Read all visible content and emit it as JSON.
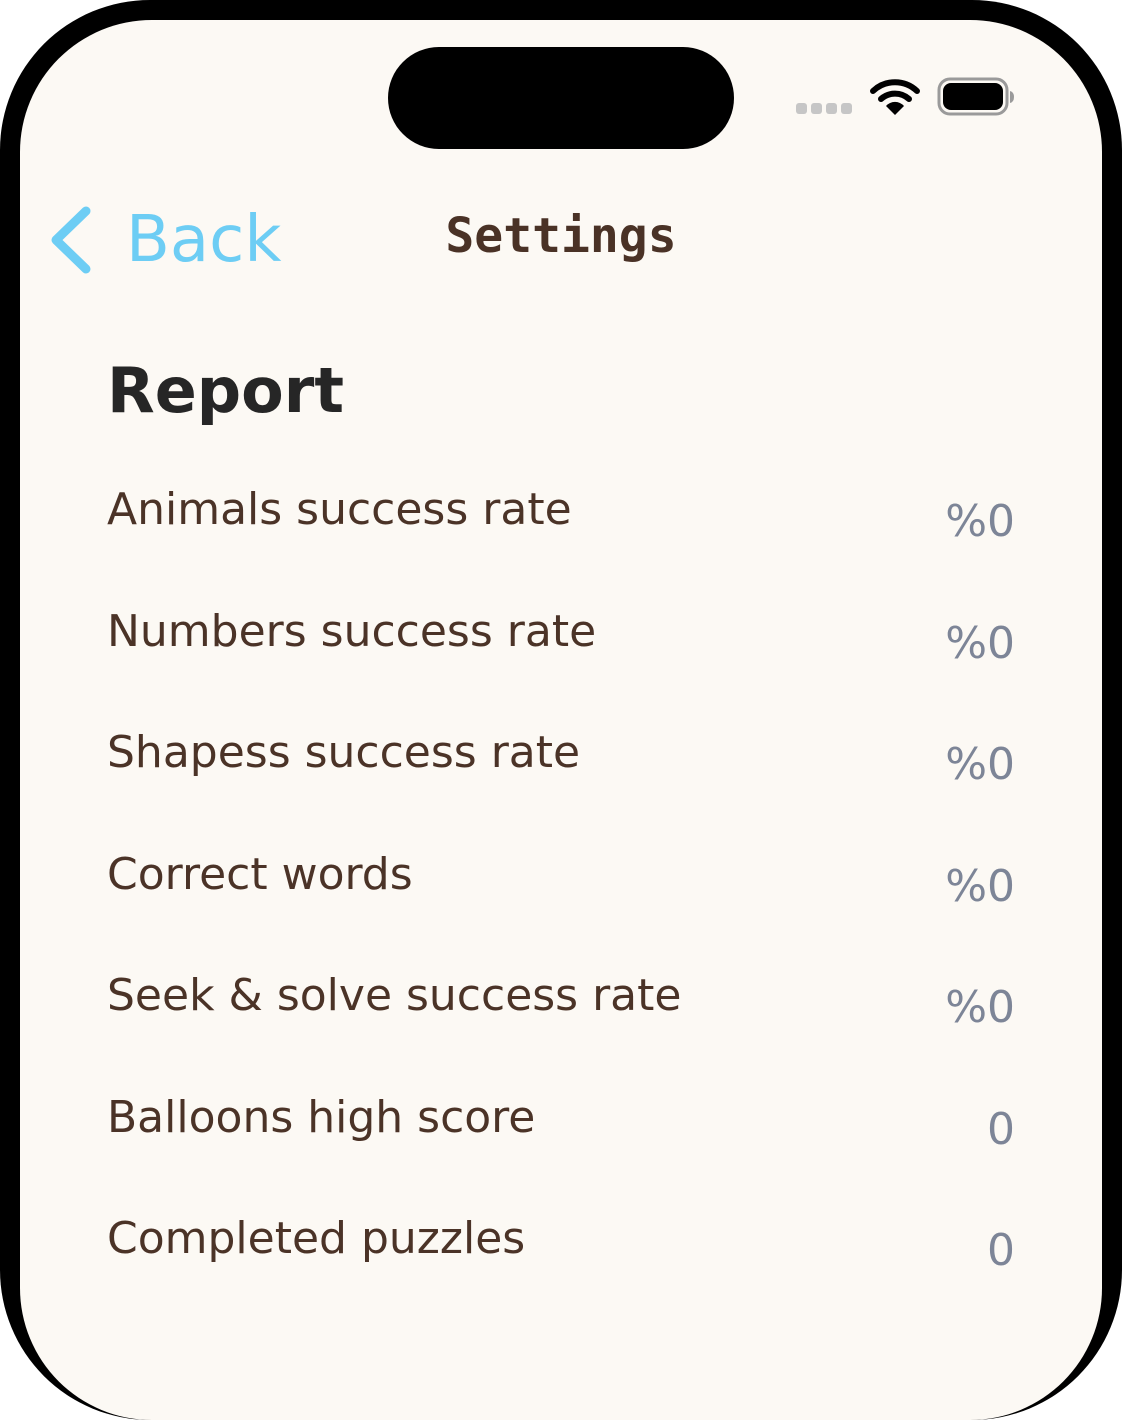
{
  "status_bar": {
    "signal_icon": "cellular-signal-icon",
    "wifi_icon": "wifi-icon",
    "battery_icon": "battery-icon"
  },
  "nav": {
    "back_label": "Back",
    "back_icon": "chevron-left-icon",
    "title": "Settings"
  },
  "section": {
    "title": "Report"
  },
  "report_rows": [
    {
      "label": "Animals success rate",
      "value": "%0"
    },
    {
      "label": "Numbers success rate",
      "value": "%0"
    },
    {
      "label": "Shapess success rate",
      "value": "%0"
    },
    {
      "label": "Correct words",
      "value": "%0"
    },
    {
      "label": "Seek & solve success rate",
      "value": "%0"
    },
    {
      "label": "Balloons high score",
      "value": "0"
    },
    {
      "label": "Completed puzzles",
      "value": "0"
    }
  ],
  "colors": {
    "background": "#fcf9f4",
    "accent": "#6dcdf4",
    "title_text": "#4a3226",
    "label_text": "#4b3327",
    "value_text": "#7d8597"
  }
}
